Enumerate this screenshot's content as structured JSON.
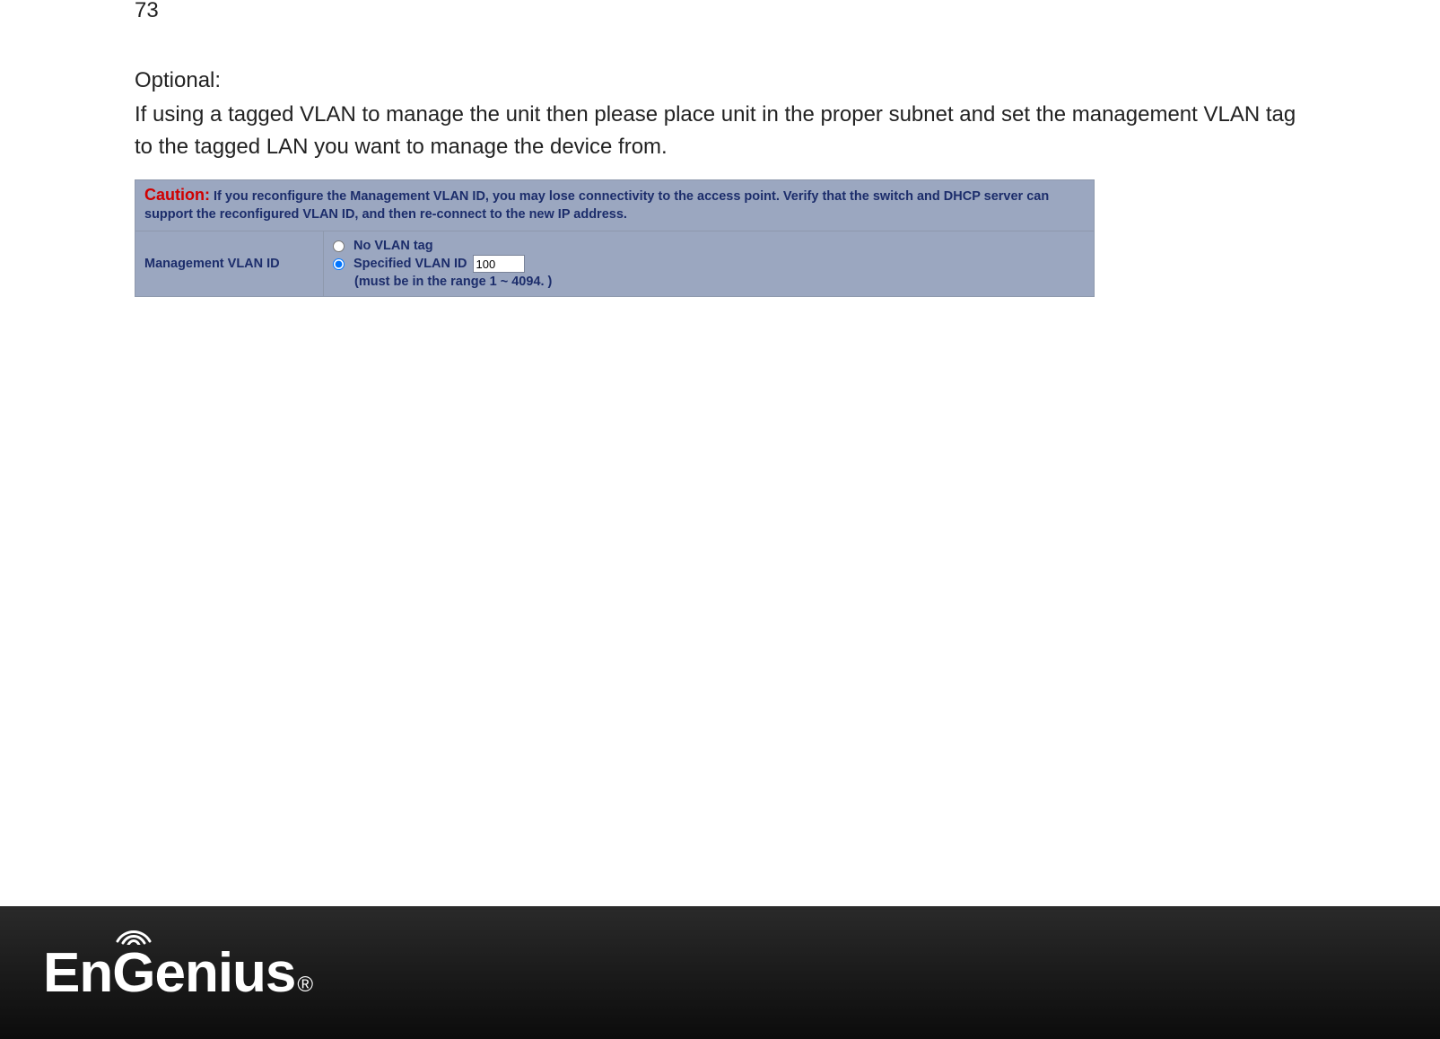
{
  "page_number": "73",
  "optional_label": "Optional:",
  "body_text": "If using a tagged VLAN to manage the unit then please place unit in the proper subnet and set the management VLAN tag to the tagged LAN you want to manage the device from.",
  "caution": {
    "label": "Caution:",
    "text": " If you reconfigure the Management VLAN ID, you may lose connectivity to the access point. Verify that the switch and DHCP server can support the reconfigured VLAN ID, and then re-connect to the new IP address."
  },
  "vlan_row": {
    "label": "Management VLAN ID",
    "option_no_tag": "No VLAN tag",
    "option_specified": "Specified VLAN ID",
    "specified_value": "100",
    "hint": "(must be in the range 1 ~ 4094. )"
  },
  "logo": {
    "text_en": "En",
    "text_g": "G",
    "text_enius": "enius",
    "reg": "®"
  }
}
